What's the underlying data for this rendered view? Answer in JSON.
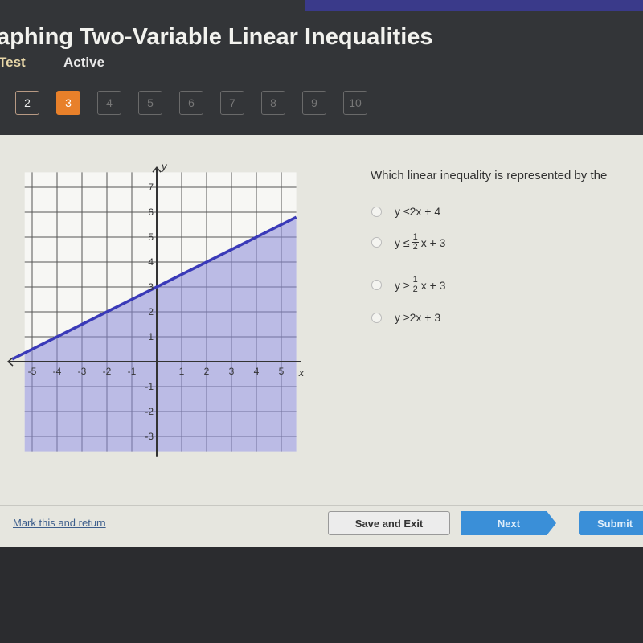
{
  "header": {
    "title": "aphing Two-Variable Linear Inequalities",
    "subtitle_test": "Test",
    "subtitle_status": "Active",
    "questions": [
      {
        "label": "2",
        "state": "answered"
      },
      {
        "label": "3",
        "state": "current"
      },
      {
        "label": "4",
        "state": "locked"
      },
      {
        "label": "5",
        "state": "locked"
      },
      {
        "label": "6",
        "state": "locked"
      },
      {
        "label": "7",
        "state": "locked"
      },
      {
        "label": "8",
        "state": "locked"
      },
      {
        "label": "9",
        "state": "locked"
      },
      {
        "label": "10",
        "state": "locked"
      }
    ],
    "current_color": "#e8802a"
  },
  "graph": {
    "x_label": "x",
    "y_label": "y",
    "x_ticks": [
      -5,
      -4,
      -3,
      -2,
      -1,
      1,
      2,
      3,
      4,
      5
    ],
    "y_ticks": [
      -3,
      -2,
      -1,
      1,
      2,
      3,
      4,
      5,
      6,
      7
    ],
    "line": {
      "slope": 0.5,
      "intercept": 3,
      "style": "solid"
    },
    "shading": "below",
    "line_color": "#3a3ab8",
    "shade_color": "#8a8ad8"
  },
  "question": {
    "prompt": "Which linear inequality is represented by the",
    "options": [
      {
        "lhs": "y ≤ ",
        "num": "",
        "den": "",
        "rhs": "2x + 4"
      },
      {
        "lhs": "y ≤ ",
        "num": "1",
        "den": "2",
        "rhs": "x + 3"
      },
      {
        "lhs": "y ≥ ",
        "num": "1",
        "den": "2",
        "rhs": "x + 3"
      },
      {
        "lhs": "y ≥ ",
        "num": "",
        "den": "",
        "rhs": "2x + 3"
      }
    ]
  },
  "footer": {
    "mark_label": "Mark this and return",
    "save_label": "Save and Exit",
    "next_label": "Next",
    "submit_label": "Submit"
  }
}
